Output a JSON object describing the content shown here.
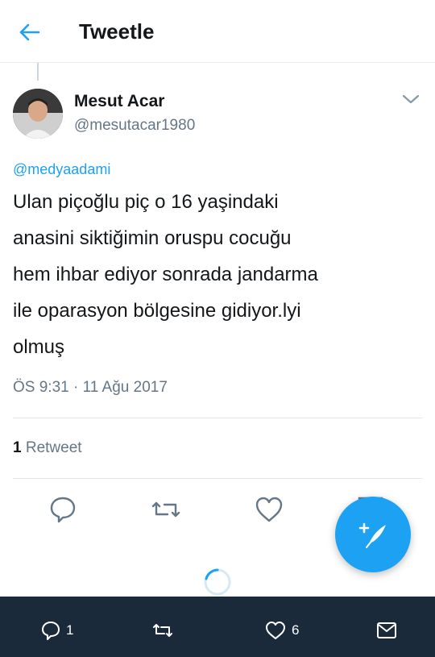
{
  "header": {
    "title": "Tweetle",
    "back_icon": "arrow-left-icon"
  },
  "tweet": {
    "author": {
      "name": "Mesut Acar",
      "handle": "@mesutacar1980"
    },
    "reply_to": "@medyaadami",
    "text": "Ulan piçoğlu piç o 16 yaşindaki\nanasini siktiğimin oruspu cocuğu\nhem ihbar ediyor sonrada jandarma\nile oparasyon bölgesine gidiyor.lyi\nolmuş",
    "timestamp": "ÖS 9:31 · 11 Ağu 2017",
    "stats": {
      "retweet_count": "1",
      "retweet_label": "Retweet"
    }
  },
  "actions": [
    "reply-icon",
    "retweet-icon",
    "like-icon",
    "share-icon"
  ],
  "fab": {
    "icon": "compose-tweet-icon"
  },
  "bottom_bar": {
    "reply_count": "1",
    "like_count": "6"
  },
  "colors": {
    "accent": "#1da1f2",
    "bottom_bar": "#1b2a3a",
    "secondary_text": "#657786"
  }
}
